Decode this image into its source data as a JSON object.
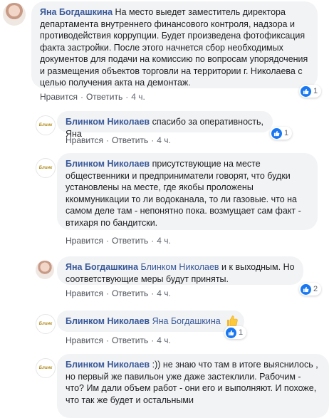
{
  "comments": [
    {
      "author": "Яна Богдашкина",
      "text": "На место выедет заместитель директора департамента внутреннего финансового контроля, надзора и противодействия коррупции. Будет произведена фотофиксация факта застройки. После этого начнется сбор необходимых документов для подачи на комиссию по вопросам упорядочения и размещения объектов торговли на территории г. Николаева с целью получения акта на демонтаж.",
      "like": "Нравится",
      "reply": "Ответить",
      "time": "4 ч.",
      "reactions": "1"
    },
    {
      "author": "Блинком Николаев",
      "text": "спасибо за оперативность, Яна",
      "like": "Нравится",
      "reply": "Ответить",
      "time": "4 ч.",
      "reactions": "1"
    },
    {
      "author": "Блинком Николаев",
      "text": "присутствующие на месте общественники и предприниматели говорят, что будки установлены на месте, где якобы проложены ккоммуникации то ли водоканала, то ли газовые. что на самом деле там - непонятно пока. возмущает сам факт - втихаря по бандитски.",
      "like": "Нравится",
      "reply": "Ответить",
      "time": "4 ч."
    },
    {
      "author": "Яна Богдашкина",
      "mention": "Блинком Николаев",
      "text": "и к выходным. Но соответствующие меры будут приняты.",
      "like": "Нравится",
      "reply": "Ответить",
      "time": "4 ч.",
      "reactions": "2"
    },
    {
      "author": "Блинком Николаев",
      "mention": "Яна Богдашкина",
      "like": "Нравится",
      "reply": "Ответить",
      "time": "4 ч.",
      "reactions": "1"
    },
    {
      "author": "Блинком Николаев",
      "text": ":)) не знаю что там в итоге выяснилось , но первый же павильон уже даже застеклили. Рабочим - что? Им дали объем работ - они его и выполняют. И похоже, что так же будет и остальными"
    }
  ],
  "logo_text": "Блинк",
  "colors": {
    "link": "#385898",
    "bubble": "#f2f3f5",
    "like": "#1877f2"
  },
  "icons": {
    "like": "like-icon",
    "emoji": "thumbs-up-emoji-icon"
  }
}
